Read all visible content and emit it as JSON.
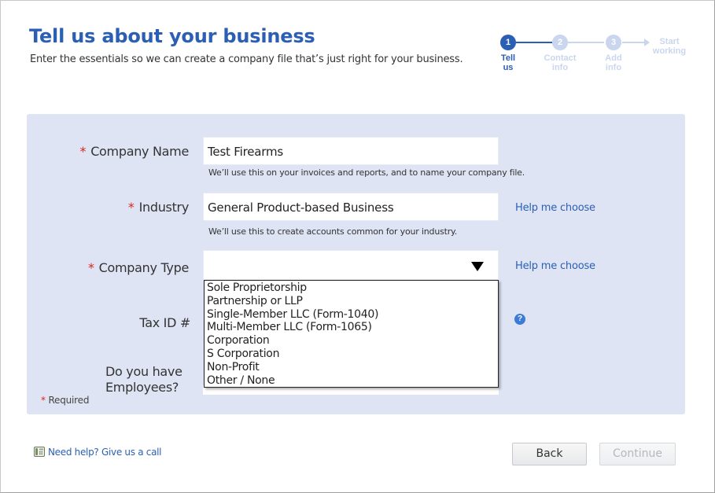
{
  "header": {
    "title": "Tell us about your business",
    "subtitle": "Enter the essentials so we can create a company file that’s just right for your business."
  },
  "stepper": {
    "steps": [
      {
        "number": "1",
        "label_line1": "Tell",
        "label_line2": "us",
        "state": "active"
      },
      {
        "number": "2",
        "label_line1": "Contact",
        "label_line2": "info",
        "state": "inactive"
      },
      {
        "number": "3",
        "label_line1": "Add",
        "label_line2": "info",
        "state": "inactive"
      },
      {
        "label_line1": "Start",
        "label_line2": "working",
        "state": "inactive"
      }
    ]
  },
  "form": {
    "required_marker": "*",
    "company_name": {
      "label": "Company Name",
      "value": "Test Firearms",
      "hint": "We’ll use this on your invoices and reports, and to name your company file."
    },
    "industry": {
      "label": "Industry",
      "value": "General Product-based Business",
      "hint": "We’ll use this to create accounts common for your industry.",
      "help_link": "Help me choose"
    },
    "company_type": {
      "label": "Company Type",
      "value": "",
      "help_link": "Help me choose",
      "options": [
        "Sole Proprietorship",
        "Partnership or LLP",
        "Single-Member LLC (Form-1040)",
        "Multi-Member LLC (Form-1065)",
        "Corporation",
        "S Corporation",
        "Non-Profit",
        "Other / None"
      ]
    },
    "tax_id": {
      "label": "Tax ID #",
      "help_icon": "?"
    },
    "employees": {
      "label_line1": "Do you have",
      "label_line2": "Employees?"
    },
    "required_note": "Required"
  },
  "footer": {
    "help_call": "Need help? Give us a call",
    "back_label": "Back",
    "continue_label": "Continue"
  },
  "colors": {
    "accent": "#2b5fb4",
    "panel": "#dfe4f4",
    "required": "#d9261c",
    "inactive_step": "#c9d6ee"
  }
}
